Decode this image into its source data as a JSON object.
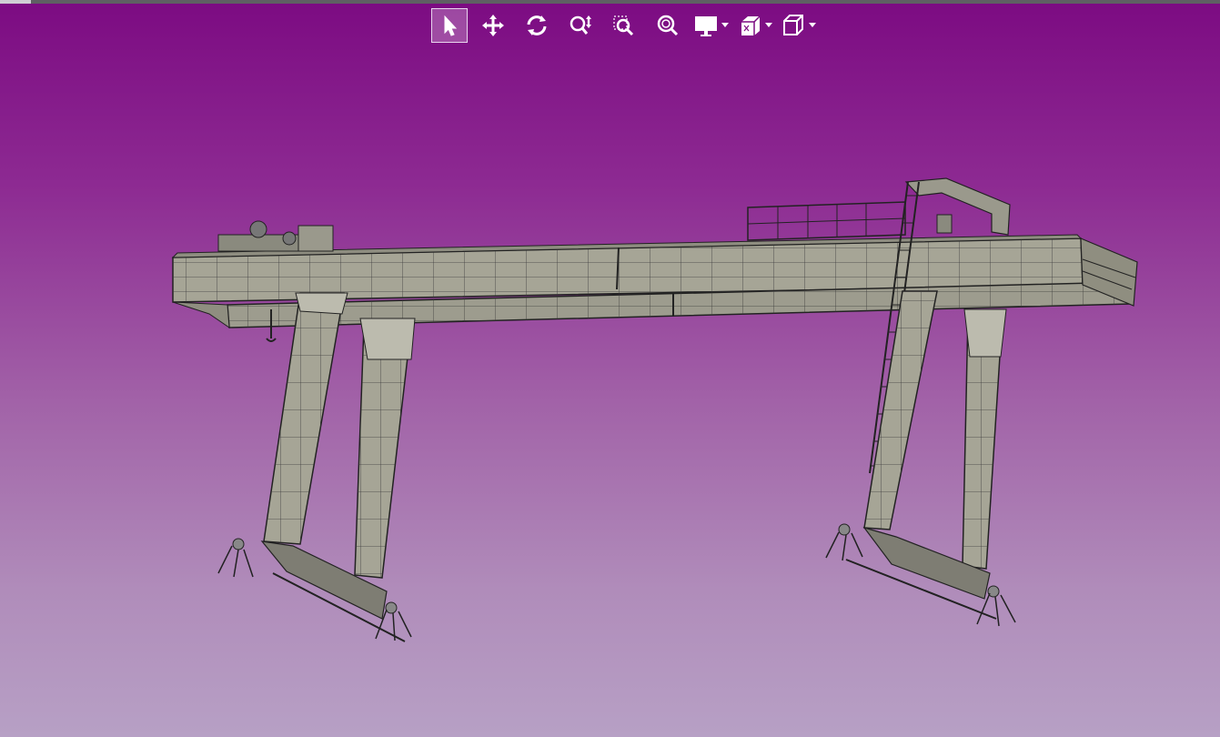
{
  "toolbar": {
    "tools": [
      {
        "id": "select",
        "icon": "cursor-arrow-icon",
        "active": true
      },
      {
        "id": "pan",
        "icon": "pan-arrows-icon",
        "active": false
      },
      {
        "id": "rotate",
        "icon": "rotate-icon",
        "active": false
      },
      {
        "id": "zoom",
        "icon": "zoom-updown-icon",
        "active": false
      },
      {
        "id": "zoom-box",
        "icon": "zoom-box-icon",
        "active": false
      },
      {
        "id": "fit-all",
        "icon": "zoom-fit-icon",
        "active": false
      },
      {
        "id": "display-mode",
        "icon": "monitor-icon",
        "dropdown": true
      },
      {
        "id": "view-orientation",
        "icon": "view-orientation-icon",
        "dropdown": true
      },
      {
        "id": "projection",
        "icon": "cube-icon",
        "dropdown": true
      }
    ]
  },
  "colors": {
    "background_top": "#7c0b82",
    "background_bottom": "#b7a0c5",
    "model_fill": "#a6a596",
    "model_edges": "#2a2a2a",
    "toolbar_icon": "#ffffff"
  }
}
